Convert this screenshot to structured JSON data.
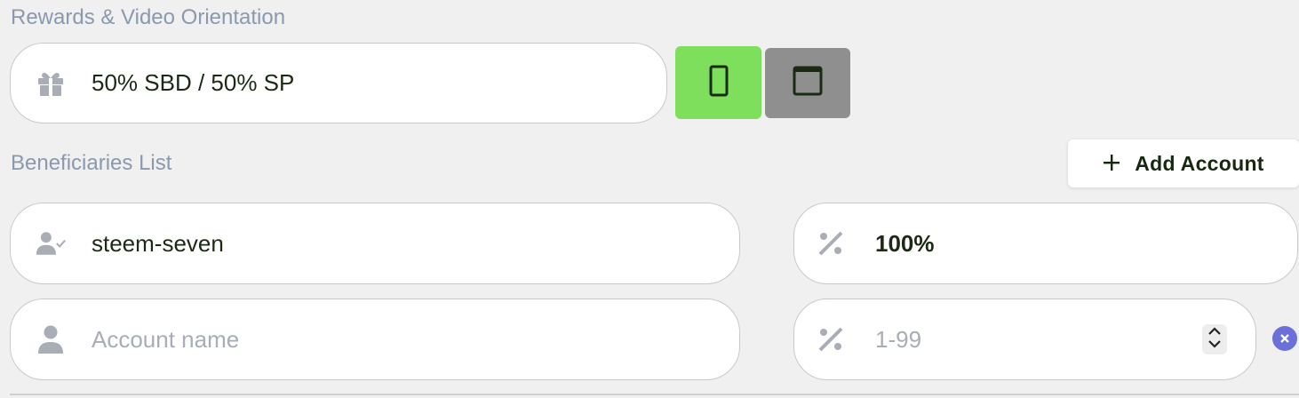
{
  "rewards_section": {
    "label": "Rewards & Video Orientation",
    "rewards_value": "50% SBD / 50% SP",
    "rewards_icon": "gift-icon",
    "orientation": {
      "portrait_icon": "portrait-icon",
      "landscape_icon": "landscape-icon",
      "selected": "portrait",
      "active_color": "#7ddf5b",
      "inactive_color": "#8f8f8f"
    }
  },
  "beneficiaries": {
    "label": "Beneficiaries List",
    "add_button_label": "Add Account",
    "add_button_icon": "plus-icon",
    "rows": [
      {
        "account": "steem-seven",
        "account_icon": "user-check-icon",
        "percent": "100%",
        "percent_icon": "percent-icon"
      }
    ],
    "new_row": {
      "account_placeholder": "Account name",
      "account_icon": "user-icon",
      "percent_placeholder": "1-99",
      "percent_icon": "percent-icon",
      "remove_icon": "close-icon"
    }
  },
  "colors": {
    "label_color": "#8a99ad",
    "text_color": "#1b2a14",
    "remove_button": "#6b6fd8"
  }
}
